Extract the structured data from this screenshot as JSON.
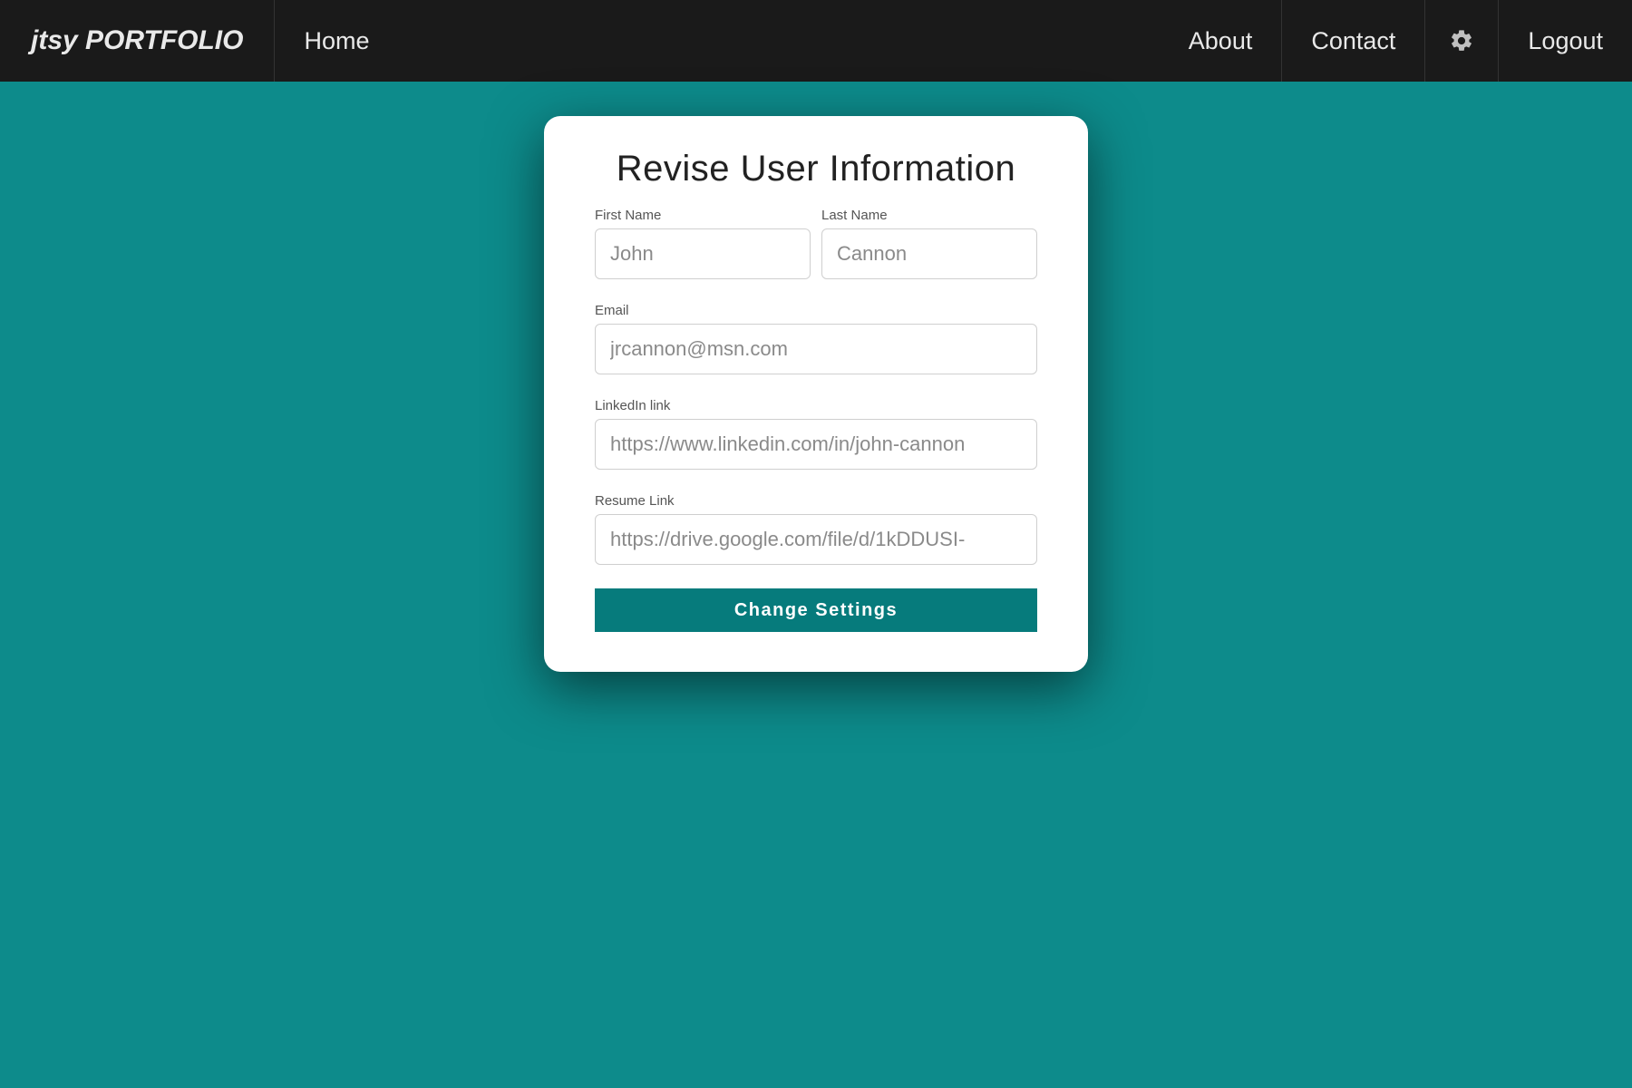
{
  "nav": {
    "brand": "jtsy PORTFOLIO",
    "home": "Home",
    "about": "About",
    "contact": "Contact",
    "logout": "Logout"
  },
  "card": {
    "title": "Revise User Information",
    "labels": {
      "first_name": "First Name",
      "last_name": "Last Name",
      "email": "Email",
      "linkedin": "LinkedIn link",
      "resume": "Resume Link"
    },
    "placeholders": {
      "first_name": "John",
      "last_name": "Cannon",
      "email": "jrcannon@msn.com",
      "linkedin": "https://www.linkedin.com/in/john-cannon",
      "resume": "https://drive.google.com/file/d/1kDDUSI-"
    },
    "submit": "Change Settings"
  }
}
